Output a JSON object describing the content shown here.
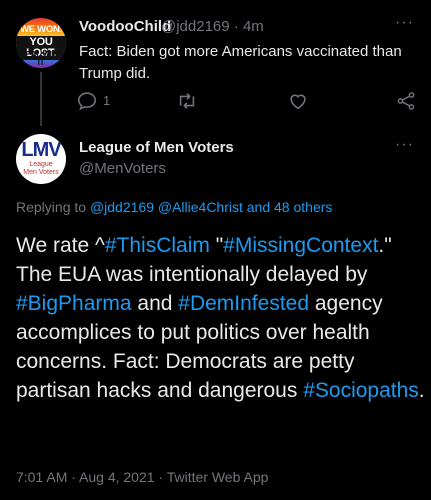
{
  "parent_tweet": {
    "avatar_text": [
      "WE WON.",
      "YOU LOST.",
      "DEAL WITH IT"
    ],
    "display_name": "VoodooChild",
    "handle": "@jdd2169",
    "time": "· 4m",
    "text": "Fact:  Biden got more Americans vaccinated than Trump did.",
    "reply_count": "1",
    "icons": [
      "reply-icon",
      "retweet-icon",
      "like-icon",
      "share-icon"
    ]
  },
  "main_tweet": {
    "avatar_text": [
      "LMV",
      "League",
      "Men Voters"
    ],
    "display_name": "League of Men Voters",
    "handle": "@MenVoters",
    "replying_prefix": "Replying to ",
    "replying_to": "@jdd2169 @Allie4Christ and 48 others",
    "text_segments": [
      {
        "t": "We rate ^",
        "tag": false
      },
      {
        "t": "#ThisClaim",
        "tag": true
      },
      {
        "t": " \"",
        "tag": false
      },
      {
        "t": "#MissingContext",
        "tag": true
      },
      {
        "t": ".\" The EUA was intentionally delayed by ",
        "tag": false
      },
      {
        "t": "#BigPharma",
        "tag": true
      },
      {
        "t": " and ",
        "tag": false
      },
      {
        "t": "#DemInfested",
        "tag": true
      },
      {
        "t": " agency accomplices to put politics over health concerns.  Fact: Democrats are petty partisan hacks and dangerous ",
        "tag": false
      },
      {
        "t": "#Sociopaths",
        "tag": true
      },
      {
        "t": ".",
        "tag": false
      }
    ],
    "meta": "7:01 AM · Aug 4, 2021 · Twitter Web App"
  },
  "colors": {
    "background": "#000000",
    "text": "#e7e9ea",
    "muted": "#71767b",
    "link": "#1d9bf0"
  }
}
